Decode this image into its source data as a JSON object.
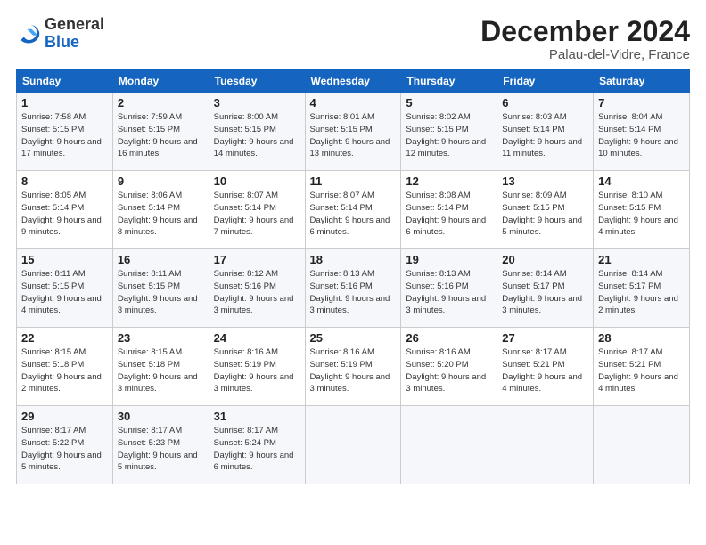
{
  "logo": {
    "general": "General",
    "blue": "Blue"
  },
  "header": {
    "month": "December 2024",
    "location": "Palau-del-Vidre, France"
  },
  "weekdays": [
    "Sunday",
    "Monday",
    "Tuesday",
    "Wednesday",
    "Thursday",
    "Friday",
    "Saturday"
  ],
  "weeks": [
    [
      {
        "day": 1,
        "sunrise": "7:58 AM",
        "sunset": "5:15 PM",
        "daylight": "9 hours and 17 minutes."
      },
      {
        "day": 2,
        "sunrise": "7:59 AM",
        "sunset": "5:15 PM",
        "daylight": "9 hours and 16 minutes."
      },
      {
        "day": 3,
        "sunrise": "8:00 AM",
        "sunset": "5:15 PM",
        "daylight": "9 hours and 14 minutes."
      },
      {
        "day": 4,
        "sunrise": "8:01 AM",
        "sunset": "5:15 PM",
        "daylight": "9 hours and 13 minutes."
      },
      {
        "day": 5,
        "sunrise": "8:02 AM",
        "sunset": "5:15 PM",
        "daylight": "9 hours and 12 minutes."
      },
      {
        "day": 6,
        "sunrise": "8:03 AM",
        "sunset": "5:14 PM",
        "daylight": "9 hours and 11 minutes."
      },
      {
        "day": 7,
        "sunrise": "8:04 AM",
        "sunset": "5:14 PM",
        "daylight": "9 hours and 10 minutes."
      }
    ],
    [
      {
        "day": 8,
        "sunrise": "8:05 AM",
        "sunset": "5:14 PM",
        "daylight": "9 hours and 9 minutes."
      },
      {
        "day": 9,
        "sunrise": "8:06 AM",
        "sunset": "5:14 PM",
        "daylight": "9 hours and 8 minutes."
      },
      {
        "day": 10,
        "sunrise": "8:07 AM",
        "sunset": "5:14 PM",
        "daylight": "9 hours and 7 minutes."
      },
      {
        "day": 11,
        "sunrise": "8:07 AM",
        "sunset": "5:14 PM",
        "daylight": "9 hours and 6 minutes."
      },
      {
        "day": 12,
        "sunrise": "8:08 AM",
        "sunset": "5:14 PM",
        "daylight": "9 hours and 6 minutes."
      },
      {
        "day": 13,
        "sunrise": "8:09 AM",
        "sunset": "5:15 PM",
        "daylight": "9 hours and 5 minutes."
      },
      {
        "day": 14,
        "sunrise": "8:10 AM",
        "sunset": "5:15 PM",
        "daylight": "9 hours and 4 minutes."
      }
    ],
    [
      {
        "day": 15,
        "sunrise": "8:11 AM",
        "sunset": "5:15 PM",
        "daylight": "9 hours and 4 minutes."
      },
      {
        "day": 16,
        "sunrise": "8:11 AM",
        "sunset": "5:15 PM",
        "daylight": "9 hours and 3 minutes."
      },
      {
        "day": 17,
        "sunrise": "8:12 AM",
        "sunset": "5:16 PM",
        "daylight": "9 hours and 3 minutes."
      },
      {
        "day": 18,
        "sunrise": "8:13 AM",
        "sunset": "5:16 PM",
        "daylight": "9 hours and 3 minutes."
      },
      {
        "day": 19,
        "sunrise": "8:13 AM",
        "sunset": "5:16 PM",
        "daylight": "9 hours and 3 minutes."
      },
      {
        "day": 20,
        "sunrise": "8:14 AM",
        "sunset": "5:17 PM",
        "daylight": "9 hours and 3 minutes."
      },
      {
        "day": 21,
        "sunrise": "8:14 AM",
        "sunset": "5:17 PM",
        "daylight": "9 hours and 2 minutes."
      }
    ],
    [
      {
        "day": 22,
        "sunrise": "8:15 AM",
        "sunset": "5:18 PM",
        "daylight": "9 hours and 2 minutes."
      },
      {
        "day": 23,
        "sunrise": "8:15 AM",
        "sunset": "5:18 PM",
        "daylight": "9 hours and 3 minutes."
      },
      {
        "day": 24,
        "sunrise": "8:16 AM",
        "sunset": "5:19 PM",
        "daylight": "9 hours and 3 minutes."
      },
      {
        "day": 25,
        "sunrise": "8:16 AM",
        "sunset": "5:19 PM",
        "daylight": "9 hours and 3 minutes."
      },
      {
        "day": 26,
        "sunrise": "8:16 AM",
        "sunset": "5:20 PM",
        "daylight": "9 hours and 3 minutes."
      },
      {
        "day": 27,
        "sunrise": "8:17 AM",
        "sunset": "5:21 PM",
        "daylight": "9 hours and 4 minutes."
      },
      {
        "day": 28,
        "sunrise": "8:17 AM",
        "sunset": "5:21 PM",
        "daylight": "9 hours and 4 minutes."
      }
    ],
    [
      {
        "day": 29,
        "sunrise": "8:17 AM",
        "sunset": "5:22 PM",
        "daylight": "9 hours and 5 minutes."
      },
      {
        "day": 30,
        "sunrise": "8:17 AM",
        "sunset": "5:23 PM",
        "daylight": "9 hours and 5 minutes."
      },
      {
        "day": 31,
        "sunrise": "8:17 AM",
        "sunset": "5:24 PM",
        "daylight": "9 hours and 6 minutes."
      },
      null,
      null,
      null,
      null
    ]
  ]
}
